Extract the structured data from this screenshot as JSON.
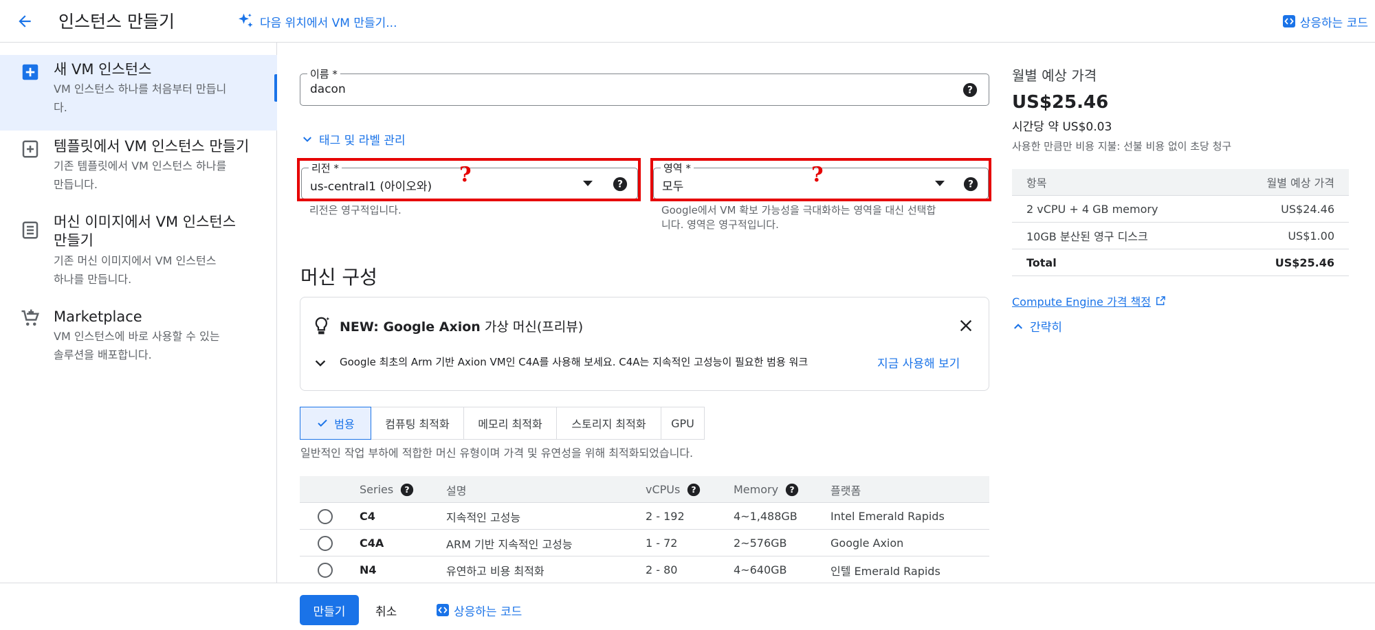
{
  "header": {
    "title": "인스턴스 만들기",
    "create_elsewhere": "다음 위치에서 VM 만들기...",
    "equivalent_code": "상응하는 코드"
  },
  "sidebar": {
    "items": [
      {
        "title": "새 VM 인스턴스",
        "desc": "VM 인스턴스 하나를 처음부터 만듭니\n다.",
        "icon": "add-box-icon",
        "active": true
      },
      {
        "title": "템플릿에서 VM 인스턴스 만들기",
        "desc": "기존 템플릿에서 VM 인스턴스 하나를\n만듭니다.",
        "icon": "template-add-icon",
        "active": false
      },
      {
        "title": "머신 이미지에서 VM 인스턴스\n만들기",
        "desc": "기존 머신 이미지에서 VM 인스턴스\n하나를 만듭니다.",
        "icon": "machine-image-icon",
        "active": false
      },
      {
        "title": "Marketplace",
        "desc": "VM 인스턴스에 바로 사용할 수 있는\n솔루션을 배포합니다.",
        "icon": "marketplace-cart-icon",
        "active": false
      }
    ]
  },
  "form": {
    "name": {
      "label": "이름 *",
      "value": "dacon"
    },
    "tags_labels_link": "태그 및 라벨 관리",
    "region": {
      "label": "리전 *",
      "value": "us-central1 (아이오와)",
      "hint": "리전은 영구적입니다."
    },
    "zone": {
      "label": "영역 *",
      "value": "모두",
      "hint": "Google에서 VM 확보 가능성을 극대화하는 영역을 대신 선택합\n니다. 영역은 영구적입니다."
    },
    "annotation_mark": "?"
  },
  "machine": {
    "section_title": "머신 구성",
    "banner": {
      "title_bold": "NEW: Google Axion",
      "title_rest": " 가상 머신(프리뷰)",
      "body": "Google 최초의 Arm 기반 Axion VM인 C4A를 사용해 보세요. C4A는 지속적인 고성능이 필요한 범용 워크",
      "action": "지금 사용해 보기"
    },
    "tabs": [
      "범용",
      "컴퓨팅 최적화",
      "메모리 최적화",
      "스토리지 최적화",
      "GPU"
    ],
    "selected_tab": "범용",
    "tab_desc": "일반적인 작업 부하에 적합한 머신 유형이며 가격 및 유연성을 위해 최적화되었습니다.",
    "table": {
      "headers": {
        "series": "Series",
        "desc": "설명",
        "vcpus": "vCPUs",
        "memory": "Memory",
        "platform": "플랫폼"
      },
      "rows": [
        {
          "series": "C4",
          "desc": "지속적인 고성능",
          "vcpus": "2 - 192",
          "memory": "4~1,488GB",
          "platform": "Intel Emerald Rapids"
        },
        {
          "series": "C4A",
          "desc": "ARM 기반 지속적인 고성능",
          "vcpus": "1 - 72",
          "memory": "2~576GB",
          "platform": "Google Axion"
        },
        {
          "series": "N4",
          "desc": "유연하고 비용 최적화",
          "vcpus": "2 - 80",
          "memory": "4~640GB",
          "platform": "인텔 Emerald Rapids"
        }
      ]
    }
  },
  "pricing": {
    "title": "월별 예상 가격",
    "monthly": "US$25.46",
    "hourly": "시간당 약 US$0.03",
    "note": "사용한 만큼만 비용 지불: 선불 비용 없이 초당 청구",
    "table": {
      "header_item": "항목",
      "header_price": "월별 예상 가격",
      "rows": [
        {
          "item": "2 vCPU + 4 GB memory",
          "price": "US$24.46"
        },
        {
          "item": "10GB 분산된 영구 디스크",
          "price": "US$1.00"
        }
      ],
      "total_label": "Total",
      "total_price": "US$25.46"
    },
    "pricing_link": "Compute Engine 가격 책정",
    "collapse": "간략히"
  },
  "footer": {
    "create": "만들기",
    "cancel": "취소",
    "equivalent_code": "상응하는 코드"
  },
  "colors": {
    "accent": "#1a73e8",
    "annotation": "#e60000"
  }
}
